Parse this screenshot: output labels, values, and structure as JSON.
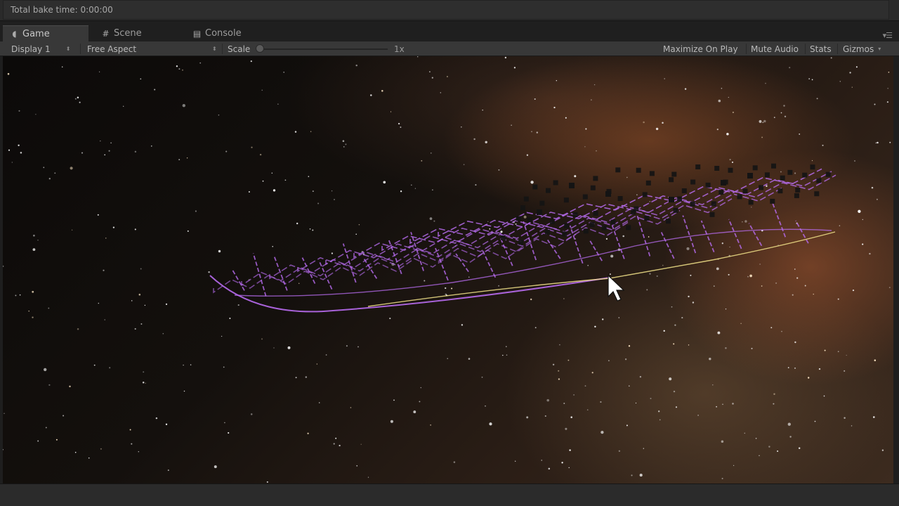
{
  "status": {
    "bake_time": "Total bake time: 0:00:00"
  },
  "tabs": [
    {
      "label": "Game",
      "icon": "pacman-icon",
      "active": true
    },
    {
      "label": "Scene",
      "icon": "grid-icon",
      "active": false
    },
    {
      "label": "Console",
      "icon": "console-icon",
      "active": false
    }
  ],
  "toolbar": {
    "display": "Display 1",
    "aspect": "Free Aspect",
    "scale_label": "Scale",
    "scale_value": "1x",
    "maximize_on_play": "Maximize On Play",
    "mute_audio": "Mute Audio",
    "stats": "Stats",
    "gizmos": "Gizmos"
  },
  "colors": {
    "editor_bg": "#383838",
    "accent_purple": "#b86cf0",
    "accent_yellow": "#f2e38a"
  }
}
